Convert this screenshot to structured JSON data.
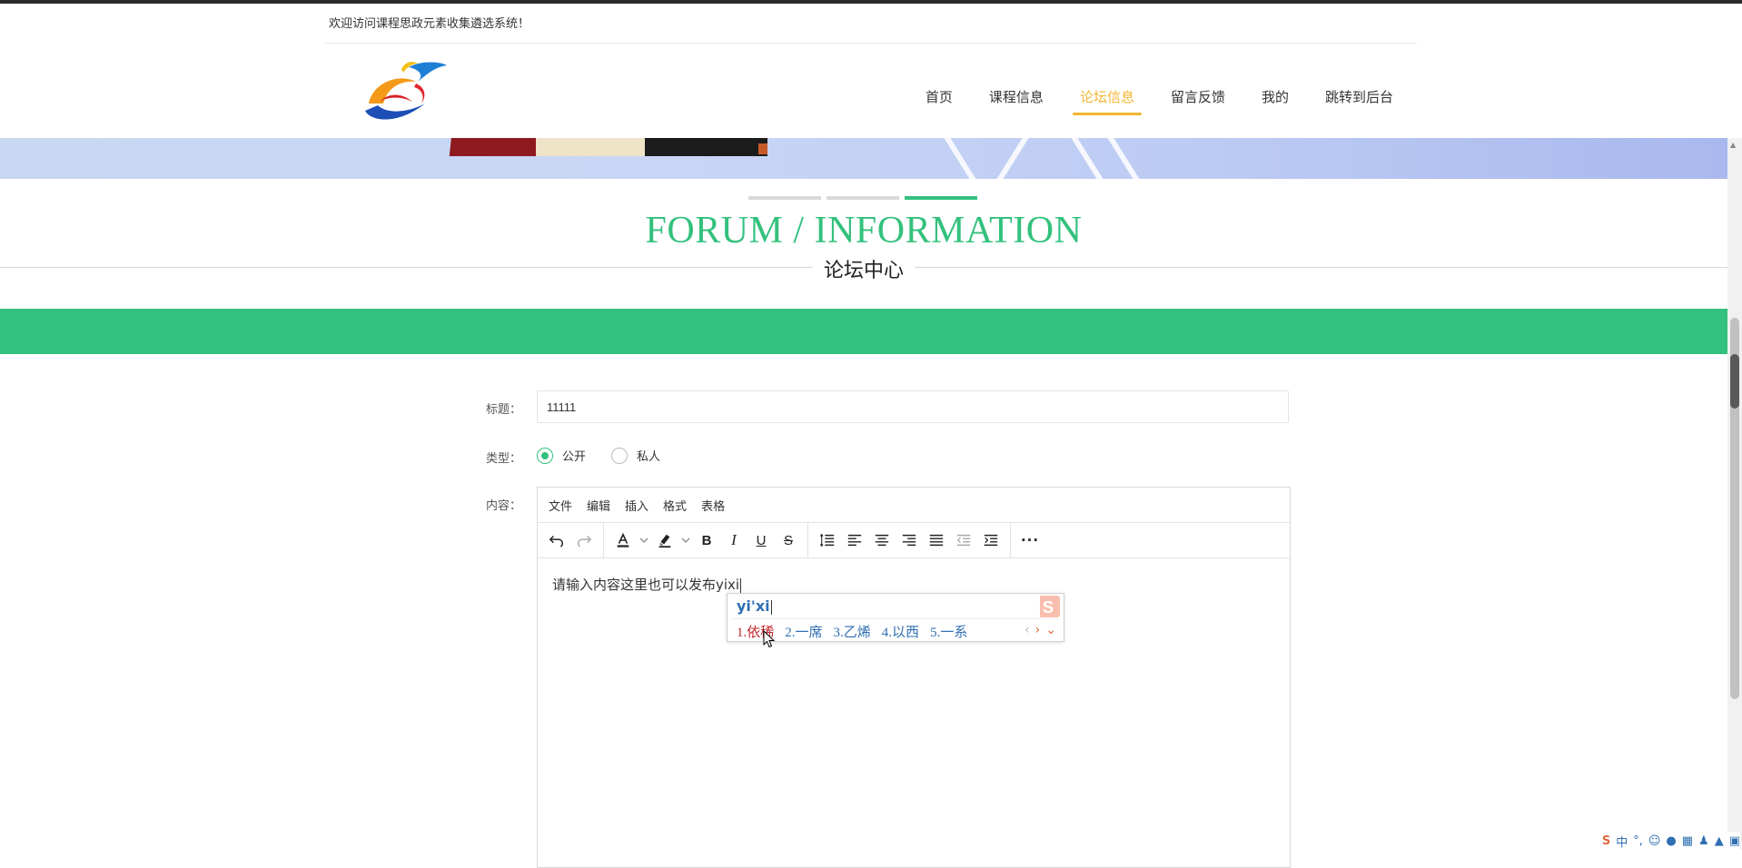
{
  "header": {
    "welcome_text": "欢迎访问课程思政元素收集遴选系统！"
  },
  "nav": {
    "items": [
      {
        "label": "首页"
      },
      {
        "label": "课程信息"
      },
      {
        "label": "论坛信息",
        "active": true
      },
      {
        "label": "留言反馈"
      },
      {
        "label": "我的"
      },
      {
        "label": "跳转到后台"
      }
    ],
    "active_color": "#f2b632"
  },
  "section": {
    "title_en": "FORUM / INFORMATION",
    "title_cn": "论坛中心",
    "accent_color": "#33c17d"
  },
  "form": {
    "title_label": "标题：",
    "title_value": "11111",
    "type_label": "类型：",
    "type_options": [
      {
        "label": "公开",
        "checked": true
      },
      {
        "label": "私人",
        "checked": false
      }
    ],
    "content_label": "内容："
  },
  "editor": {
    "menus": [
      "文件",
      "编辑",
      "插入",
      "格式",
      "表格"
    ],
    "toolbar_icons": [
      "undo-icon",
      "redo-icon",
      "font-color-icon",
      "highlight-icon",
      "bold-icon",
      "italic-icon",
      "underline-icon",
      "strikethrough-icon",
      "line-height-icon",
      "align-left-icon",
      "align-center-icon",
      "align-right-icon",
      "align-justify-icon",
      "outdent-icon",
      "indent-icon",
      "more-icon"
    ],
    "content_text": "请输入内容这里也可以发布yixi"
  },
  "ime": {
    "composition": "yi'xi",
    "candidates": [
      "1.依稀",
      "2.一席",
      "3.乙烯",
      "4.以西",
      "5.一系"
    ],
    "selected_index": 0
  },
  "tray": {
    "items": [
      "中",
      "°,"
    ]
  }
}
